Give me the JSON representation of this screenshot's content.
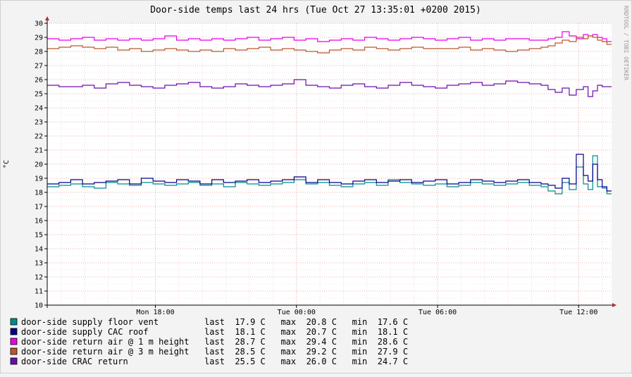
{
  "chart_data": {
    "type": "line",
    "title": "Door-side temps last 24 hrs (Tue Oct 27 13:35:01 +0200 2015)",
    "ylabel": "°C",
    "xlabel": "",
    "watermark": "RRDTOOL / TOBI OETIKER",
    "ylim": [
      10,
      30
    ],
    "xlim": [
      0,
      24
    ],
    "yticks": [
      "10",
      "11",
      "12",
      "13",
      "14",
      "15",
      "16",
      "17",
      "18",
      "19",
      "20",
      "21",
      "22",
      "23",
      "24",
      "25",
      "26",
      "27",
      "28",
      "29",
      "30"
    ],
    "xticks": [
      {
        "label": "Mon 18:00",
        "x": 4.6
      },
      {
        "label": "Tue 00:00",
        "x": 10.6
      },
      {
        "label": "Tue 06:00",
        "x": 16.6
      },
      {
        "label": "Tue 12:00",
        "x": 22.6
      }
    ],
    "grid": true,
    "background": "#ffffff",
    "grid_color": "#e6b0b0",
    "series": [
      {
        "name": "door-side supply floor vent",
        "color": "#008b8b",
        "last": "17.9 C",
        "max": "20.8 C",
        "min": "17.6 C",
        "x": [
          0,
          0.5,
          1,
          1.5,
          2,
          2.5,
          3,
          3.5,
          4,
          4.5,
          5,
          5.5,
          6,
          6.5,
          7,
          7.5,
          8,
          8.5,
          9,
          9.5,
          10,
          10.5,
          11,
          11.5,
          12,
          12.5,
          13,
          13.5,
          14,
          14.5,
          15,
          15.5,
          16,
          16.5,
          17,
          17.5,
          18,
          18.5,
          19,
          19.5,
          20,
          20.5,
          21,
          21.3,
          21.6,
          21.9,
          22.2,
          22.5,
          22.8,
          23,
          23.2,
          23.4,
          23.6,
          23.8
        ],
        "values": [
          18.4,
          18.5,
          18.6,
          18.4,
          18.3,
          18.7,
          18.6,
          18.5,
          18.7,
          18.6,
          18.5,
          18.6,
          18.7,
          18.5,
          18.6,
          18.4,
          18.7,
          18.6,
          18.5,
          18.6,
          18.7,
          18.9,
          18.6,
          18.7,
          18.5,
          18.4,
          18.6,
          18.7,
          18.5,
          18.9,
          18.7,
          18.6,
          18.5,
          18.6,
          18.4,
          18.5,
          18.7,
          18.6,
          18.5,
          18.6,
          18.7,
          18.5,
          18.4,
          18.1,
          17.9,
          18.7,
          18.2,
          19.8,
          18.6,
          18.2,
          20.6,
          18.4,
          18.3,
          17.9
        ]
      },
      {
        "name": "door-side supply CAC roof",
        "color": "#00008b",
        "last": "18.1 C",
        "max": "20.7 C",
        "min": "18.1 C",
        "x": [
          0,
          0.5,
          1,
          1.5,
          2,
          2.5,
          3,
          3.5,
          4,
          4.5,
          5,
          5.5,
          6,
          6.5,
          7,
          7.5,
          8,
          8.5,
          9,
          9.5,
          10,
          10.5,
          11,
          11.5,
          12,
          12.5,
          13,
          13.5,
          14,
          14.5,
          15,
          15.5,
          16,
          16.5,
          17,
          17.5,
          18,
          18.5,
          19,
          19.5,
          20,
          20.5,
          21,
          21.3,
          21.6,
          21.9,
          22.2,
          22.5,
          22.8,
          23,
          23.2,
          23.4,
          23.6,
          23.8
        ],
        "values": [
          18.6,
          18.7,
          18.9,
          18.6,
          18.7,
          18.8,
          18.9,
          18.6,
          19.0,
          18.8,
          18.7,
          18.9,
          18.8,
          18.6,
          18.9,
          18.7,
          18.8,
          18.9,
          18.7,
          18.8,
          18.9,
          19.1,
          18.7,
          18.9,
          18.7,
          18.6,
          18.8,
          18.9,
          18.7,
          18.8,
          18.9,
          18.7,
          18.8,
          18.9,
          18.6,
          18.7,
          18.9,
          18.8,
          18.7,
          18.8,
          18.9,
          18.7,
          18.6,
          18.5,
          18.3,
          19.0,
          18.6,
          20.7,
          19.2,
          18.8,
          20.0,
          18.9,
          18.4,
          18.1
        ]
      },
      {
        "name": "door-side return air @ 1 m height",
        "color": "#e600e6",
        "last": "28.7 C",
        "max": "29.4 C",
        "min": "28.6 C",
        "x": [
          0,
          0.5,
          1,
          1.5,
          2,
          2.5,
          3,
          3.5,
          4,
          4.5,
          5,
          5.5,
          6,
          6.5,
          7,
          7.5,
          8,
          8.5,
          9,
          9.5,
          10,
          10.5,
          11,
          11.5,
          12,
          12.5,
          13,
          13.5,
          14,
          14.5,
          15,
          15.5,
          16,
          16.5,
          17,
          17.5,
          18,
          18.5,
          19,
          19.5,
          20,
          20.5,
          21,
          21.3,
          21.6,
          21.9,
          22.2,
          22.5,
          22.8,
          23,
          23.2,
          23.4,
          23.6,
          23.8
        ],
        "values": [
          28.9,
          28.8,
          28.9,
          29.0,
          28.8,
          28.9,
          28.8,
          28.9,
          28.8,
          28.9,
          29.1,
          28.8,
          28.9,
          28.8,
          28.9,
          28.8,
          28.9,
          29.0,
          28.8,
          28.9,
          29.0,
          28.8,
          28.9,
          28.7,
          28.8,
          28.9,
          28.8,
          29.0,
          28.9,
          28.8,
          28.9,
          29.0,
          28.9,
          28.8,
          28.9,
          29.0,
          28.8,
          28.9,
          28.8,
          28.9,
          28.9,
          28.8,
          28.8,
          28.9,
          29.0,
          29.4,
          29.1,
          28.9,
          29.2,
          29.1,
          29.2,
          29.0,
          28.9,
          28.7
        ]
      },
      {
        "name": "door-side return air @ 3 m height",
        "color": "#b8582b",
        "last": "28.5 C",
        "max": "29.2 C",
        "min": "27.9 C",
        "x": [
          0,
          0.5,
          1,
          1.5,
          2,
          2.5,
          3,
          3.5,
          4,
          4.5,
          5,
          5.5,
          6,
          6.5,
          7,
          7.5,
          8,
          8.5,
          9,
          9.5,
          10,
          10.5,
          11,
          11.5,
          12,
          12.5,
          13,
          13.5,
          14,
          14.5,
          15,
          15.5,
          16,
          16.5,
          17,
          17.5,
          18,
          18.5,
          19,
          19.5,
          20,
          20.5,
          21,
          21.3,
          21.6,
          21.9,
          22.2,
          22.5,
          22.8,
          23,
          23.2,
          23.4,
          23.6,
          23.8
        ],
        "values": [
          28.2,
          28.3,
          28.4,
          28.3,
          28.2,
          28.3,
          28.1,
          28.2,
          28.0,
          28.1,
          28.2,
          28.1,
          28.0,
          28.1,
          28.0,
          28.2,
          28.1,
          28.2,
          28.3,
          28.1,
          28.2,
          28.1,
          28.0,
          27.9,
          28.1,
          28.2,
          28.1,
          28.3,
          28.2,
          28.1,
          28.2,
          28.3,
          28.2,
          28.2,
          28.2,
          28.3,
          28.1,
          28.2,
          28.1,
          28.0,
          28.1,
          28.2,
          28.3,
          28.4,
          28.6,
          28.8,
          28.7,
          29.0,
          28.9,
          29.1,
          29.0,
          28.8,
          28.7,
          28.5
        ]
      },
      {
        "name": "door-side CRAC return",
        "color": "#6a0dad",
        "last": "25.5 C",
        "max": "26.0 C",
        "min": "24.7 C",
        "x": [
          0,
          0.5,
          1,
          1.5,
          2,
          2.5,
          3,
          3.5,
          4,
          4.5,
          5,
          5.5,
          6,
          6.5,
          7,
          7.5,
          8,
          8.5,
          9,
          9.5,
          10,
          10.5,
          11,
          11.5,
          12,
          12.5,
          13,
          13.5,
          14,
          14.5,
          15,
          15.5,
          16,
          16.5,
          17,
          17.5,
          18,
          18.5,
          19,
          19.5,
          20,
          20.5,
          21,
          21.3,
          21.6,
          21.9,
          22.2,
          22.5,
          22.8,
          23,
          23.2,
          23.4,
          23.6,
          23.8
        ],
        "values": [
          25.6,
          25.5,
          25.5,
          25.6,
          25.4,
          25.7,
          25.8,
          25.6,
          25.5,
          25.4,
          25.6,
          25.7,
          25.8,
          25.5,
          25.4,
          25.5,
          25.7,
          25.6,
          25.5,
          25.6,
          25.7,
          26.0,
          25.6,
          25.5,
          25.4,
          25.6,
          25.7,
          25.5,
          25.4,
          25.6,
          25.8,
          25.6,
          25.5,
          25.4,
          25.6,
          25.7,
          25.8,
          25.6,
          25.7,
          25.9,
          25.8,
          25.7,
          25.6,
          25.3,
          25.1,
          25.4,
          24.9,
          25.3,
          25.5,
          24.8,
          25.2,
          25.6,
          25.5,
          25.5
        ]
      }
    ]
  }
}
